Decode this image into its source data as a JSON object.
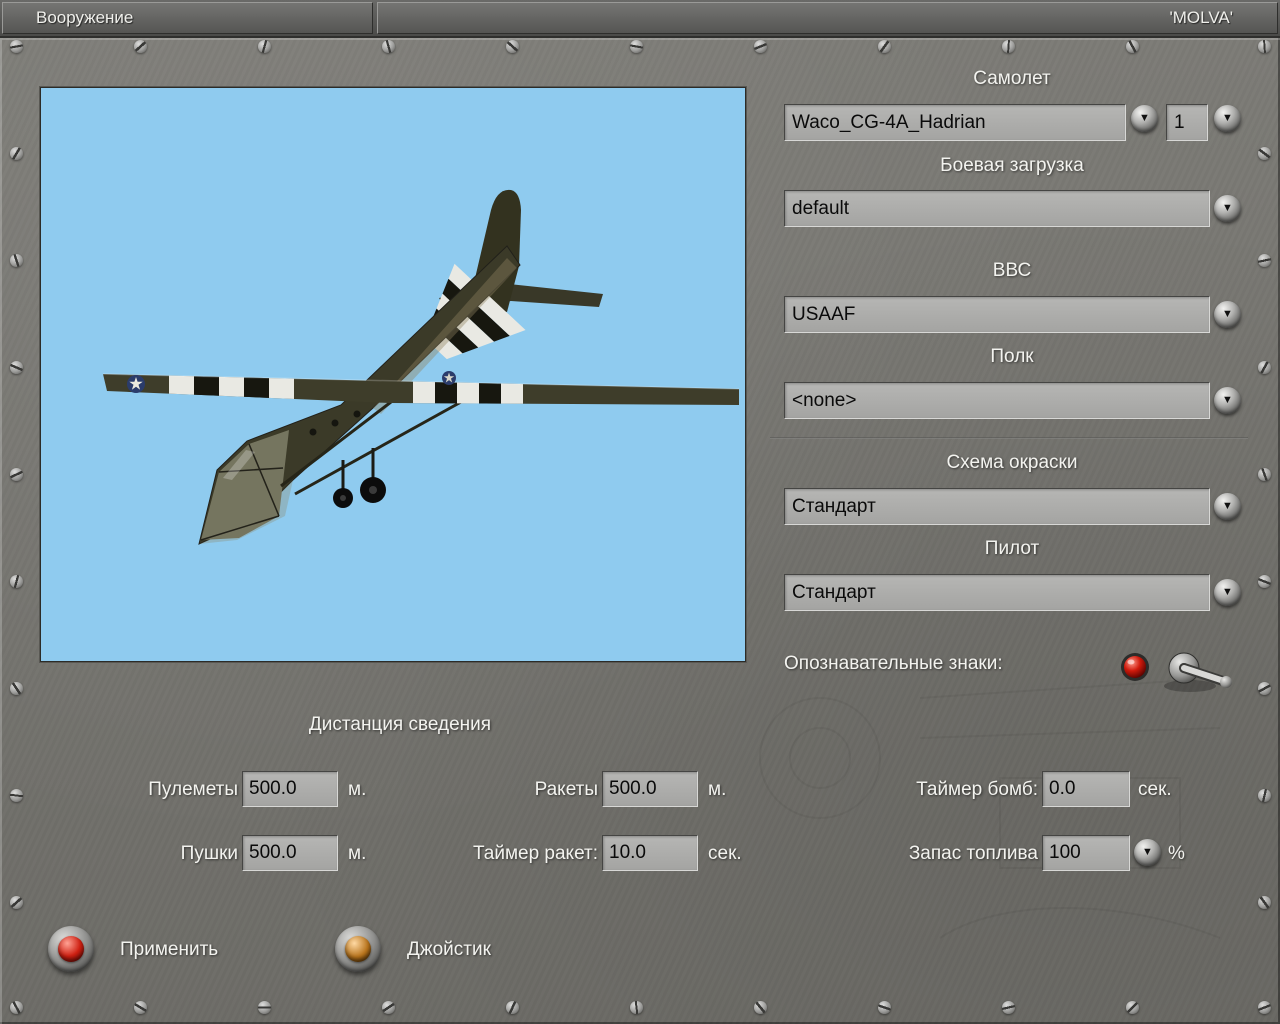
{
  "titlebar": {
    "armament_tab": "Вооружение",
    "title": "'MOLVA'"
  },
  "aircraft": {
    "label": "Самолет",
    "value": "Waco_CG-4A_Hadrian",
    "count": "1"
  },
  "loadout": {
    "label": "Боевая загрузка",
    "value": "default"
  },
  "airforce": {
    "label": "ВВС",
    "value": "USAAF"
  },
  "regiment": {
    "label": "Полк",
    "value": "<none>"
  },
  "paint_scheme": {
    "label": "Схема окраски",
    "value": "Стандарт"
  },
  "pilot": {
    "label": "Пилот",
    "value": "Стандарт"
  },
  "markings": {
    "label": "Опознавательные знаки:"
  },
  "convergence": {
    "title": "Дистанция сведения",
    "machine_guns": {
      "label": "Пулеметы",
      "value": "500.0",
      "unit": "м."
    },
    "cannons": {
      "label": "Пушки",
      "value": "500.0",
      "unit": "м."
    },
    "rockets": {
      "label": "Ракеты",
      "value": "500.0",
      "unit": "м."
    },
    "rocket_timer": {
      "label": "Таймер ракет:",
      "value": "10.0",
      "unit": "сек."
    },
    "bomb_timer": {
      "label": "Таймер бомб:",
      "value": "0.0",
      "unit": "сек."
    },
    "fuel": {
      "label": "Запас топлива",
      "value": "100",
      "unit": "%"
    }
  },
  "actions": {
    "apply": "Применить",
    "joystick": "Джойстик"
  },
  "icons": {
    "dropdown_arrow": "▼"
  },
  "colors": {
    "panel": "#75746f",
    "sky": "#8fcbef",
    "apply_lamp": "#cf1f12",
    "joystick_lamp": "#b8741c"
  }
}
